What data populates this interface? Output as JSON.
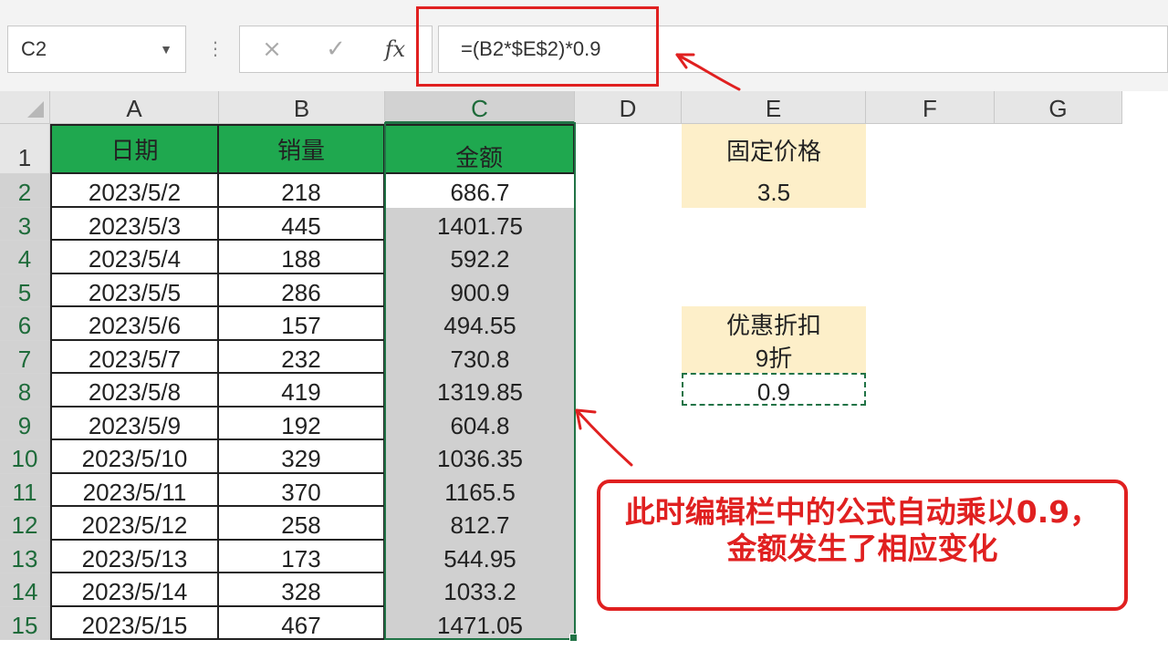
{
  "name_box": {
    "value": "C2"
  },
  "formula_bar": {
    "cancel_icon": "×",
    "enter_icon": "✓",
    "fx_label": "fx",
    "formula": "=(B2*$E$2)*0.9"
  },
  "columns": [
    "A",
    "B",
    "C",
    "D",
    "E",
    "F",
    "G"
  ],
  "table": {
    "headers": [
      "日期",
      "销量",
      "金额"
    ],
    "rows": [
      {
        "row": "2",
        "date": "2023/5/2",
        "qty": "218",
        "amount": "686.7"
      },
      {
        "row": "3",
        "date": "2023/5/3",
        "qty": "445",
        "amount": "1401.75"
      },
      {
        "row": "4",
        "date": "2023/5/4",
        "qty": "188",
        "amount": "592.2"
      },
      {
        "row": "5",
        "date": "2023/5/5",
        "qty": "286",
        "amount": "900.9"
      },
      {
        "row": "6",
        "date": "2023/5/6",
        "qty": "157",
        "amount": "494.55"
      },
      {
        "row": "7",
        "date": "2023/5/7",
        "qty": "232",
        "amount": "730.8"
      },
      {
        "row": "8",
        "date": "2023/5/8",
        "qty": "419",
        "amount": "1319.85"
      },
      {
        "row": "9",
        "date": "2023/5/9",
        "qty": "192",
        "amount": "604.8"
      },
      {
        "row": "10",
        "date": "2023/5/10",
        "qty": "329",
        "amount": "1036.35"
      },
      {
        "row": "11",
        "date": "2023/5/11",
        "qty": "370",
        "amount": "1165.5"
      },
      {
        "row": "12",
        "date": "2023/5/12",
        "qty": "258",
        "amount": "812.7"
      },
      {
        "row": "13",
        "date": "2023/5/13",
        "qty": "173",
        "amount": "544.95"
      },
      {
        "row": "14",
        "date": "2023/5/14",
        "qty": "328",
        "amount": "1033.2"
      },
      {
        "row": "15",
        "date": "2023/5/15",
        "qty": "467",
        "amount": "1471.05"
      }
    ]
  },
  "side": {
    "price_label": "固定价格",
    "price_value": "3.5",
    "discount_label": "优惠折扣",
    "discount_text": "9折",
    "discount_value": "0.9"
  },
  "annotation": {
    "text": "此时编辑栏中的公式自动乘以0.9，金额发生了相应变化"
  },
  "colors": {
    "header_green": "#1fa84f",
    "selection_green": "#217346",
    "note_red": "#e02020",
    "yellow_fill": "#fdefc9"
  }
}
